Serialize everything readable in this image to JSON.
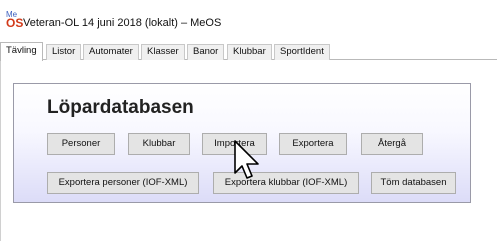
{
  "window": {
    "icon_top": "Me",
    "icon_bottom": "OS",
    "title": "Veteran-OL 14 juni 2018 (lokalt) – MeOS"
  },
  "tabs": [
    {
      "label": "Tävling",
      "active": true
    },
    {
      "label": "Listor",
      "active": false
    },
    {
      "label": "Automater",
      "active": false
    },
    {
      "label": "Klasser",
      "active": false
    },
    {
      "label": "Banor",
      "active": false
    },
    {
      "label": "Klubbar",
      "active": false
    },
    {
      "label": "SportIdent",
      "active": false
    }
  ],
  "panel": {
    "title": "Löpardatabasen",
    "row1": [
      "Personer",
      "Klubbar",
      "Importera",
      "Exportera",
      "Återgå"
    ],
    "row2": [
      "Exportera personer (IOF-XML)",
      "Exportera klubbar (IOF-XML)",
      "Töm databasen"
    ]
  },
  "colors": {
    "panel_gradient_bottom": "#dcdcf8",
    "button_bg": "#e4e4e4",
    "icon_me": "#3a5fbf",
    "icon_os": "#d23a1a"
  }
}
